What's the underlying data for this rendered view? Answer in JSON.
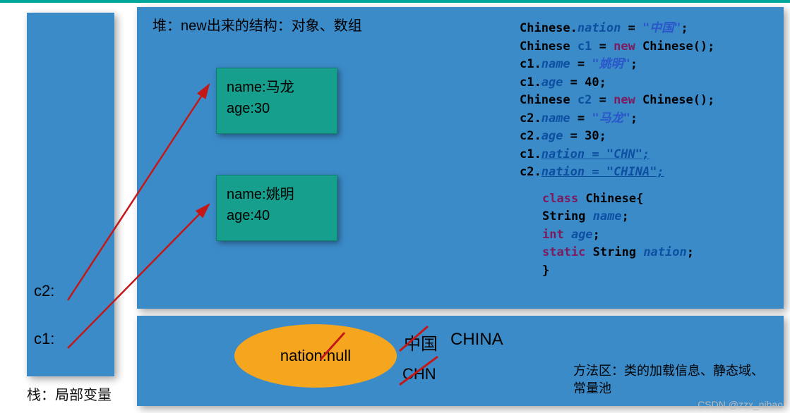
{
  "stack": {
    "label": "栈：局部变量",
    "c1": "c1:",
    "c2": "c2:"
  },
  "heap": {
    "label": "堆：new出来的结构：对象、数组",
    "obj1": {
      "name_line": "name:马龙",
      "age_line": "age:30"
    },
    "obj2": {
      "name_line": "name:姚明",
      "age_line": "age:40"
    }
  },
  "method_area": {
    "nation_label": "nation:null",
    "val_cn": "中国",
    "val_china": "CHINA",
    "val_chn": "CHN",
    "desc": "方法区：类的加载信息、静态域、常量池"
  },
  "code": {
    "l1": {
      "a": "Chinese.",
      "b": "nation",
      "c": " = ",
      "d": "\"中国\"",
      "e": ";"
    },
    "l2": {
      "a": "Chinese ",
      "b": "c1",
      "c": " = ",
      "d": "new",
      "e": " Chinese();"
    },
    "l3": {
      "a": "c1.",
      "b": "name",
      "c": " = ",
      "d": "\"姚明\"",
      "e": ";"
    },
    "l4": {
      "a": "c1.",
      "b": "age",
      "c": " = 40;"
    },
    "l5": {
      "a": "Chinese ",
      "b": "c2",
      "c": " = ",
      "d": "new",
      "e": " Chinese();"
    },
    "l6": {
      "a": "c2.",
      "b": "name",
      "c": " = ",
      "d": "\"马龙\"",
      "e": ";"
    },
    "l7": {
      "a": "c2.",
      "b": "age",
      "c": " = 30;"
    },
    "l8": {
      "a": "c1.",
      "b": "nation = \"CHN\";"
    },
    "l9": {
      "a": "c2.",
      "b": "nation = \"CHINA\";"
    },
    "cls": {
      "l1a": "class",
      "l1b": " Chinese{",
      "l2a": "String ",
      "l2b": "name",
      "l2c": ";",
      "l3a": "int",
      "l3b": " age",
      "l3c": ";",
      "l4a": "static",
      "l4b": " String ",
      "l4c": "nation",
      "l4d": ";",
      "l5": "}"
    }
  },
  "watermark": "CSDN @zzx_nihao"
}
